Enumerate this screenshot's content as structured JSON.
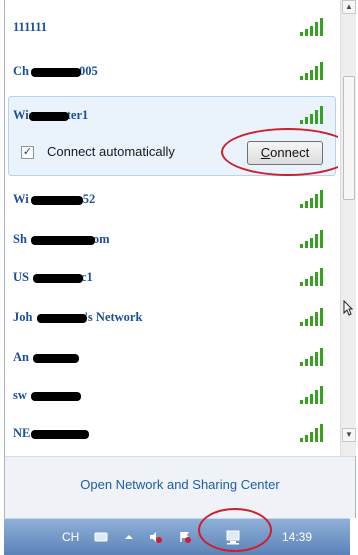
{
  "networks": [
    {
      "name": "111111",
      "redact": false
    },
    {
      "name": "Ch",
      "suffix": "005",
      "redact": true
    },
    {
      "name": "Wi",
      "suffix": "ter1",
      "redact": true
    },
    {
      "name": "Wi",
      "suffix": "52",
      "redact": true
    },
    {
      "name": "Sh",
      "suffix": "om",
      "redact": true
    },
    {
      "name": "US",
      "suffix": "c1",
      "redact": true
    },
    {
      "name": "Joh",
      "suffix": "'s Network",
      "redact": true
    },
    {
      "name": "An",
      "suffix": "",
      "redact": true
    },
    {
      "name": "sw",
      "suffix": "",
      "redact": true
    },
    {
      "name": "NE",
      "suffix": "",
      "redact": true
    }
  ],
  "selected": {
    "auto_connect_label": "Connect automatically",
    "auto_connect_checked": "✓",
    "connect_letter": "C",
    "connect_rest": "onnect"
  },
  "footer": {
    "link": "Open Network and Sharing Center"
  },
  "taskbar": {
    "lang": "CH",
    "time": "14:39"
  },
  "colors": {
    "link": "#1c4f9c",
    "signal": "#3aa022",
    "highlight": "#d01f2a"
  }
}
